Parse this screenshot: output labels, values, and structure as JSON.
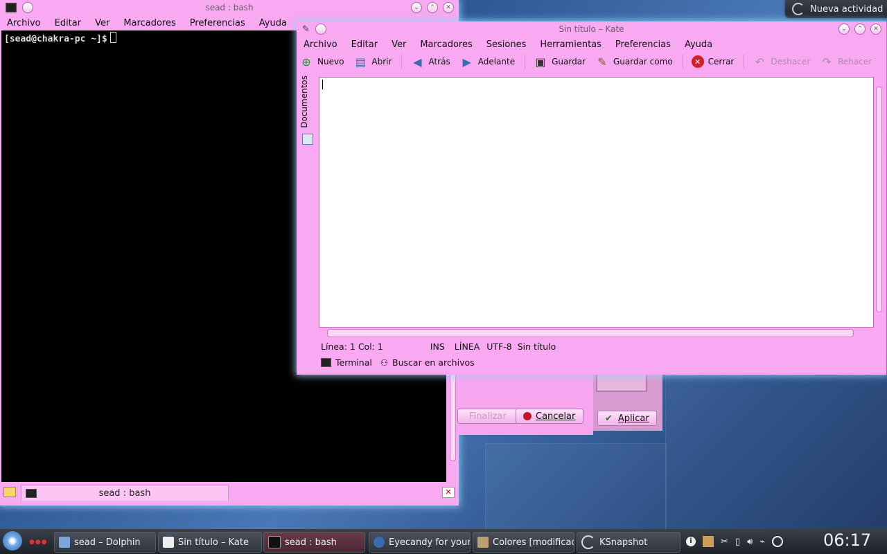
{
  "desktop": {
    "widget": "Nueva actividad"
  },
  "terminal": {
    "title": "sead : bash",
    "menu": [
      "Archivo",
      "Editar",
      "Ver",
      "Marcadores",
      "Preferencias",
      "Ayuda"
    ],
    "prompt": "[sead@chakra-pc ~]$",
    "tab_label": "sead : bash"
  },
  "dialog": {
    "finish": "Finalizar",
    "cancel": "Cancelar",
    "apply": "Aplicar"
  },
  "kate": {
    "title": "Sin título – Kate",
    "menu": [
      "Archivo",
      "Editar",
      "Ver",
      "Marcadores",
      "Sesiones",
      "Herramientas",
      "Preferencias",
      "Ayuda"
    ],
    "toolbar": {
      "new": "Nuevo",
      "open": "Abrir",
      "back": "Atrás",
      "forward": "Adelante",
      "save": "Guardar",
      "save_as": "Guardar como",
      "close": "Cerrar",
      "undo": "Deshacer",
      "redo": "Rehacer"
    },
    "sidebar_label": "Documentos",
    "status": {
      "position": "Línea: 1 Col: 1",
      "mode": "INS",
      "select_mode": "LÍNEA",
      "encoding": "UTF-8",
      "filename": "Sin título"
    },
    "toolviews": {
      "terminal": "Terminal",
      "search": "Buscar en archivos"
    }
  },
  "taskbar": {
    "tasks": [
      "sead – Dolphin",
      "Sin título – Kate",
      "sead : bash",
      "Eyecandy for your",
      "Colores [modificad",
      "KSnapshot"
    ],
    "clock": "06:17"
  },
  "colors": {
    "window_pink": "#f9a8f2",
    "panel_dark": "#2a2e36",
    "glow": "#96d2ff"
  }
}
